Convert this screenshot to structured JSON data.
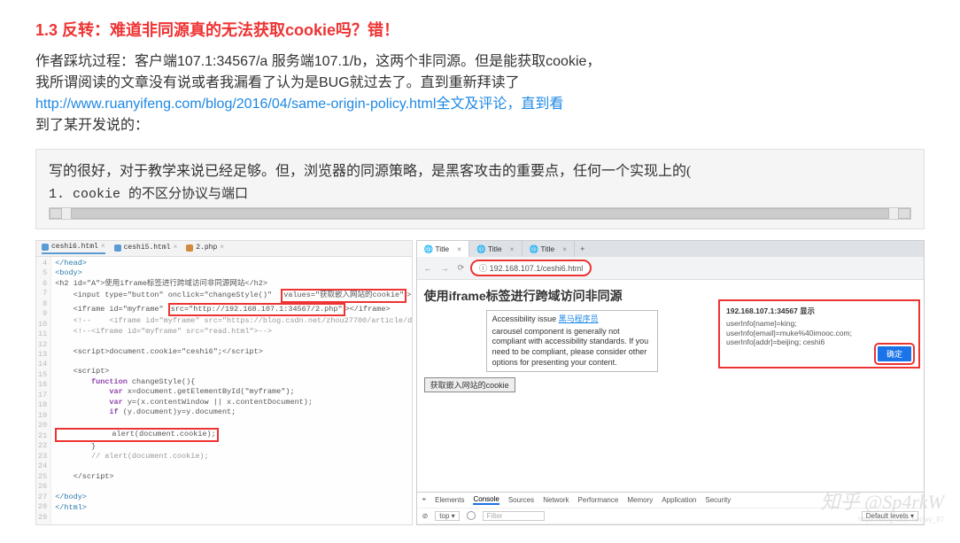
{
  "heading": "1.3 反转：难道非同源真的无法获取cookie吗？错！",
  "para": {
    "line1": "作者踩坑过程：客户端107.1:34567/a 服务端107.1/b，这两个非同源。但是能获取cookie，",
    "line2": "我所谓阅读的文章没有说或者我漏看了认为是BUG就过去了。直到重新拜读了",
    "link": "http://www.ruanyifeng.com/blog/2016/04/same-origin-policy.html",
    "link_suffix": "全文及评论，直到看",
    "line3": "到了某开发说的："
  },
  "quote": {
    "line1": "写的很好，对于教学来说已经足够。但，浏览器的同源策略，是黑客攻击的重要点，任何一个实现上的(",
    "line2": "1.  cookie 的不区分协议与端口"
  },
  "editor": {
    "tabs": [
      "ceshi6.html",
      "ceshi5.html",
      "2.php"
    ],
    "gutter_start": 4,
    "gutter_end": 29,
    "lines": [
      {
        "raw": "</head>",
        "cls": "c-tag"
      },
      {
        "raw": "<body>",
        "cls": "c-tag"
      },
      {
        "raw": "<h2 id=\"A\">使用iframe标签进行跨域访问非同源网站</h2>",
        "cls": ""
      },
      {
        "raw": "    <input type=\"button\" onclick=\"changeStyle()\"  values=\"获取嵌入网站的cookie\">",
        "cls": "",
        "boxAttr": "values=\"获取嵌入网站的cookie\""
      },
      {
        "raw": "    <iframe id=\"myframe\" src=\"http://192.168.107.1:34567/2.php\"></iframe>",
        "cls": "",
        "boxAttr": "src=\"http://192.168.107.1:34567/2.php\""
      },
      {
        "raw": "    <!--    <iframe id=\"myframe\" src=\"https://blog.csdn.net/zhou27700/article/d",
        "cls": "c-cmt"
      },
      {
        "raw": "    <!--<iframe id=\"myframe\" src=\"read.html\">-->",
        "cls": "c-cmt"
      },
      {
        "raw": ""
      },
      {
        "raw": "    <script>document.cookie=\"ceshi6\";</script>",
        "cls": ""
      },
      {
        "raw": ""
      },
      {
        "raw": "    <script>",
        "cls": ""
      },
      {
        "raw": "        function changeStyle(){",
        "cls": "",
        "kw": "function"
      },
      {
        "raw": "            var x=document.getElementById(\"myframe\");",
        "cls": "",
        "kw": "var"
      },
      {
        "raw": "            var y=(x.contentWindow || x.contentDocument);",
        "cls": "",
        "kw": "var"
      },
      {
        "raw": "            if (y.document)y=y.document;",
        "cls": "",
        "kw": "if"
      },
      {
        "raw": ""
      },
      {
        "raw": "            alert(document.cookie);",
        "cls": "",
        "boxFull": true
      },
      {
        "raw": "        }",
        "cls": ""
      },
      {
        "raw": "        // alert(document.cookie);",
        "cls": "c-cmt"
      },
      {
        "raw": ""
      },
      {
        "raw": "    </script>",
        "cls": ""
      },
      {
        "raw": ""
      },
      {
        "raw": "</body>",
        "cls": "c-tag"
      },
      {
        "raw": "</html>",
        "cls": "c-tag"
      }
    ]
  },
  "browser": {
    "tabs": [
      {
        "label": "Title",
        "active": true
      },
      {
        "label": "Title",
        "active": false
      },
      {
        "label": "Title",
        "active": false
      }
    ],
    "url": "192.168.107.1/ceshi6.html",
    "page_title": "使用iframe标签进行跨域访问非同源",
    "acc": {
      "head": "Accessibility issue",
      "link": "黑马程序员",
      "body": "carousel component is generally not compliant with accessibility standards. If you need to be compliant, please consider other options for presenting your content."
    },
    "cookie_btn": "获取嵌入网站的cookie",
    "alert": {
      "title": "192.168.107.1:34567 显示",
      "body": "userInfo[name]=king; userInfo[email]=muke%40imooc.com; userInfo[addr]=beijing; ceshi6",
      "btn": "确定"
    },
    "devtools": {
      "tabs": [
        "Elements",
        "Console",
        "Sources",
        "Network",
        "Performance",
        "Memory",
        "Application",
        "Security"
      ],
      "active": "Console",
      "top": "top",
      "filter": "Filter",
      "levels": "Default levels"
    }
  },
  "watermark": "知乎 @Sp4rkW",
  "watermark_url": "https://blog.csdn.net/wy_97"
}
